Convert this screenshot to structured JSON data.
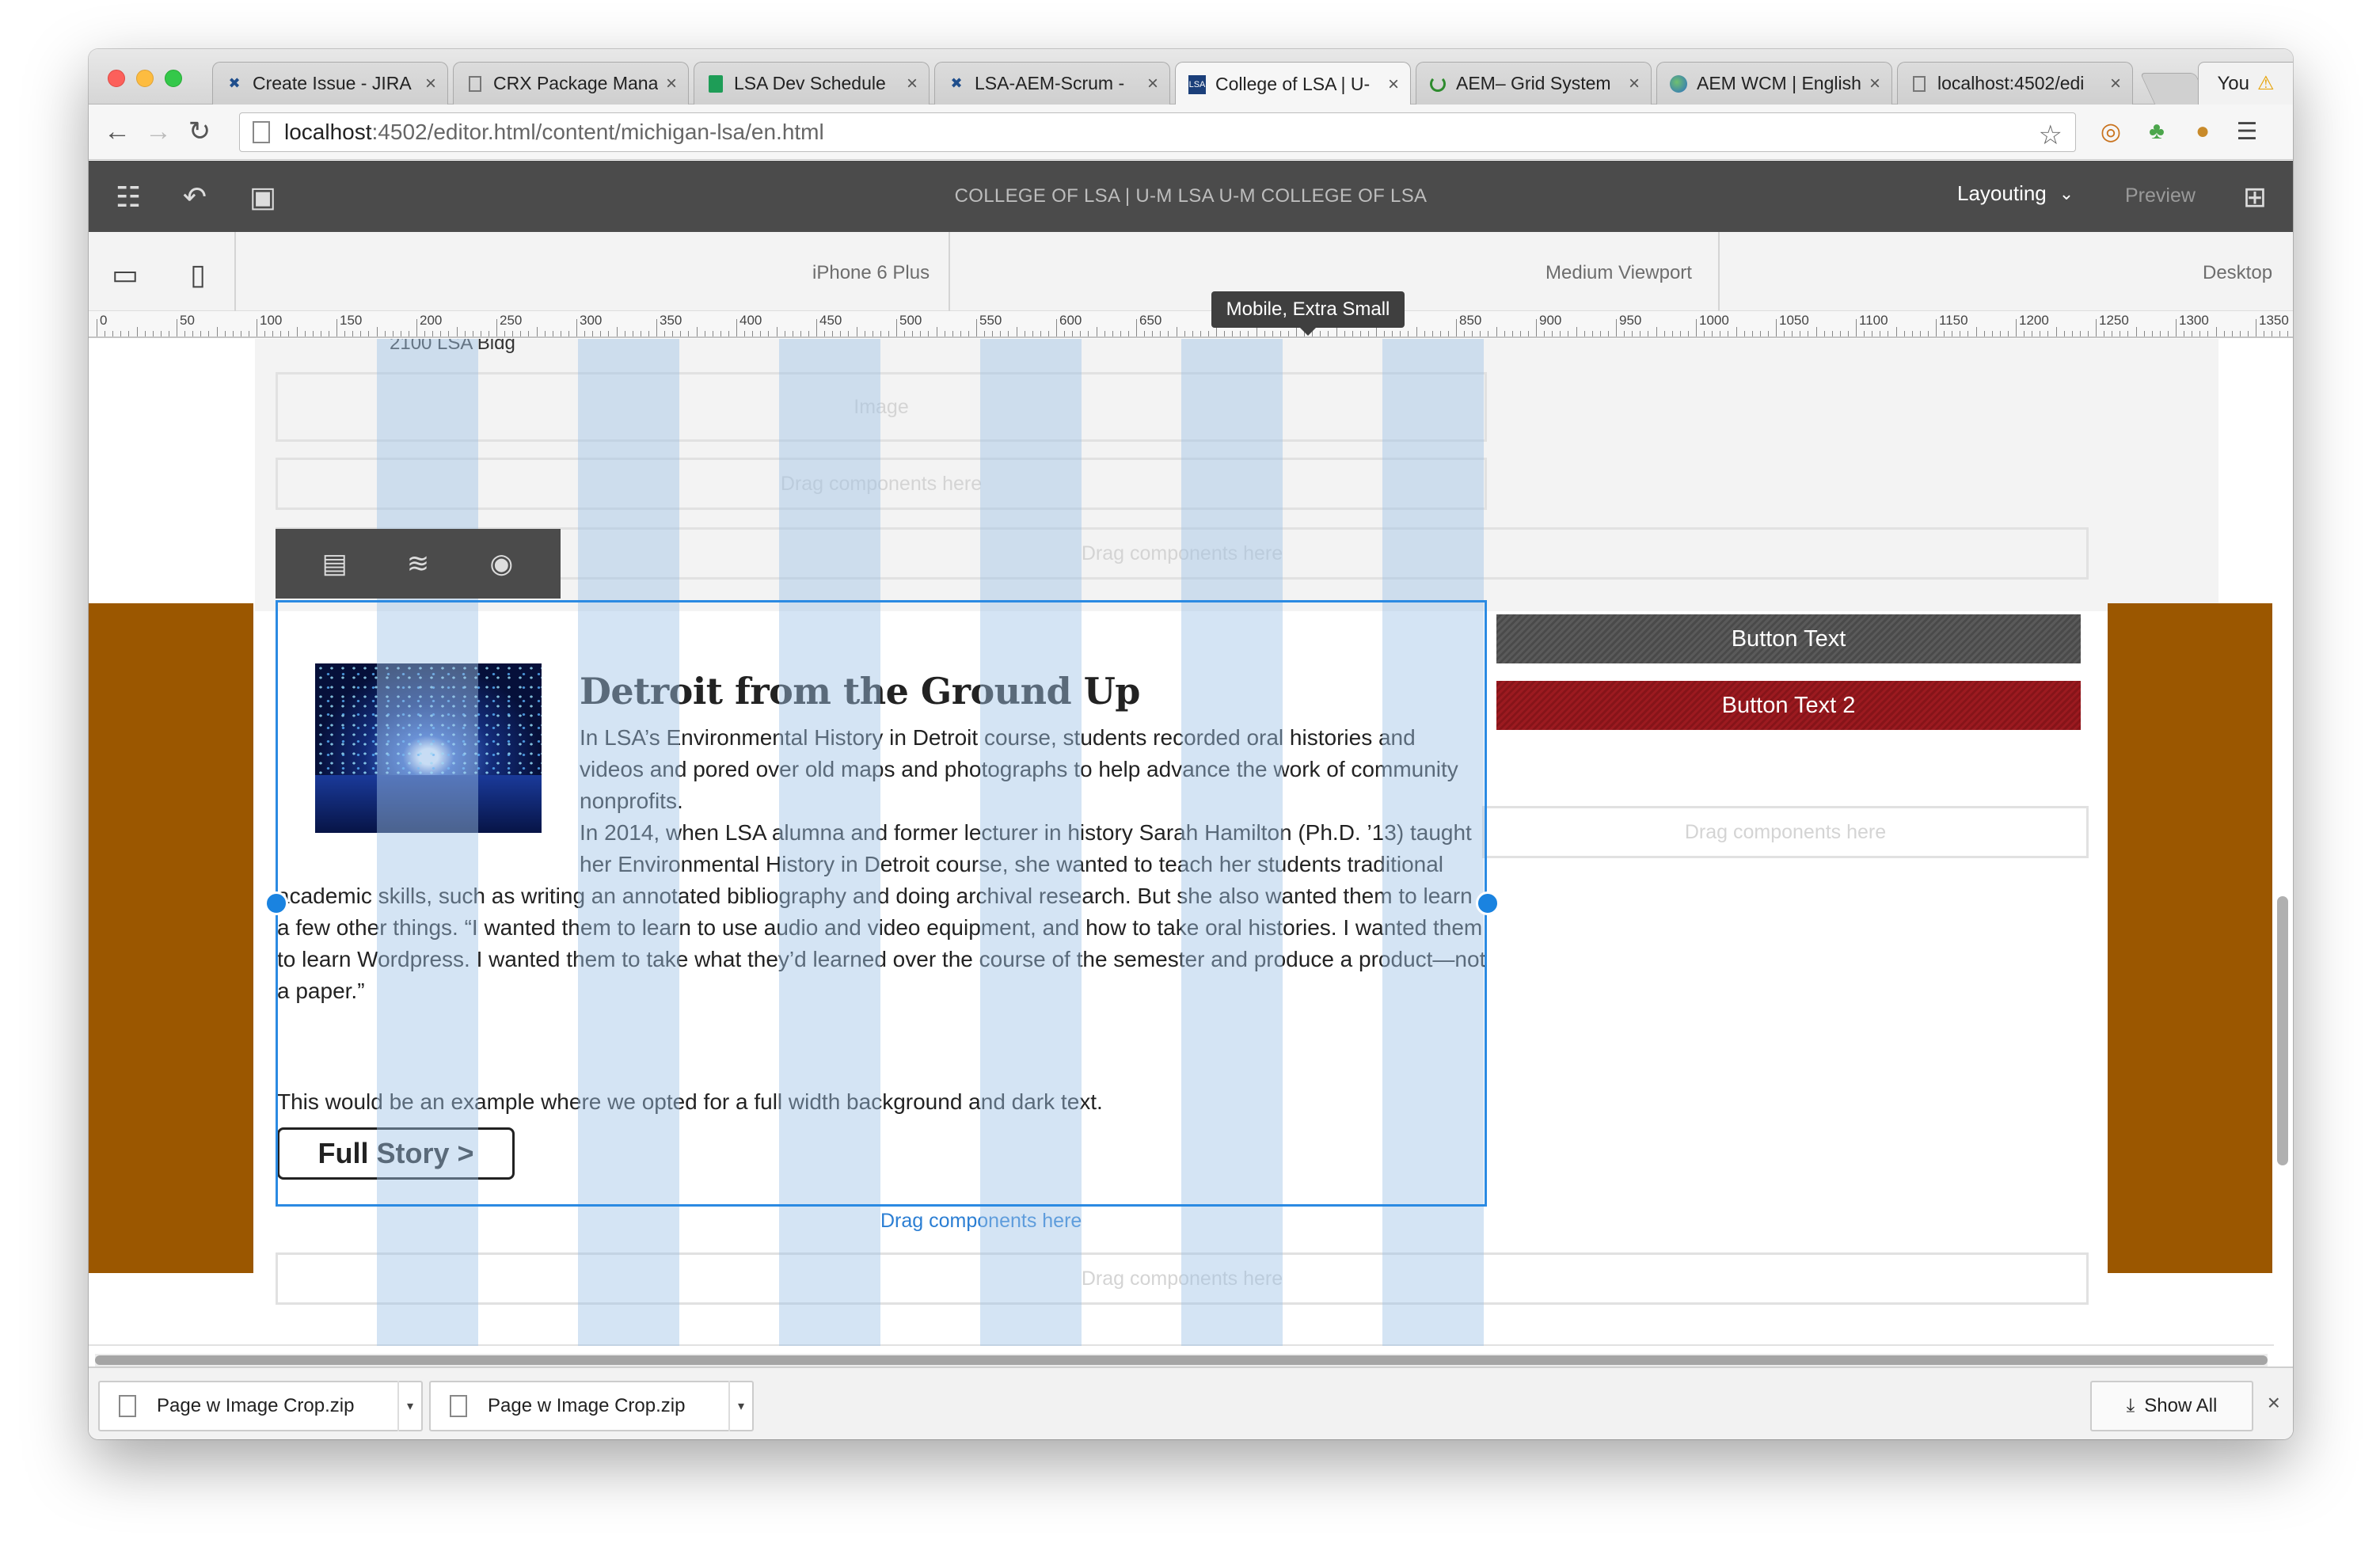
{
  "browser": {
    "tabs": [
      {
        "label": "Create Issue - JIRA",
        "icon": "jira-icon"
      },
      {
        "label": "CRX Package Manager",
        "icon": "page-icon"
      },
      {
        "label": "LSA Dev Schedule",
        "icon": "sheets-icon"
      },
      {
        "label": "LSA-AEM-Scrum -",
        "icon": "jira-icon"
      },
      {
        "label": "College of LSA | U-",
        "icon": "lsa-icon"
      },
      {
        "label": "AEM– Grid System",
        "icon": "loading-icon"
      },
      {
        "label": "AEM WCM | English",
        "icon": "globe-icon"
      },
      {
        "label": "localhost:4502/edi",
        "icon": "page-icon"
      }
    ],
    "active_tab_index": 4,
    "profile_label": "You",
    "url_host": "localhost",
    "url_rest": ":4502/editor.html/content/michigan-lsa/en.html"
  },
  "editor": {
    "title": "COLLEGE OF LSA | U-M LSA U-M COLLEGE OF LSA",
    "mode_label": "Layouting",
    "preview_label": "Preview"
  },
  "emulator": {
    "labels": [
      "iPhone 6 Plus",
      "Medium Viewport",
      "Desktop"
    ],
    "tooltip": "Mobile, Extra Small",
    "ruler_ticks": [
      "0",
      "50",
      "100",
      "150",
      "200",
      "250",
      "300",
      "350",
      "400",
      "450",
      "500",
      "550",
      "600",
      "650",
      "700",
      "750",
      "800",
      "850",
      "900",
      "950",
      "1000",
      "1050",
      "1100",
      "1150",
      "1200",
      "1250",
      "1300",
      "1350"
    ]
  },
  "page": {
    "address_line": "2100 LSA Bldg",
    "image_placeholder": "Image",
    "drag_here": "Drag components here",
    "story": {
      "title": "Detroit from the Ground Up",
      "para1": "In LSA’s Environmental History in Detroit course, students recorded oral histories and videos and pored over old maps and photographs to help advance the work of community nonprofits.",
      "para2_line1": "In 2014, when LSA alumna and former lecturer in history Sarah Hamilton (Ph.D. ’13) taught",
      "para2_line2": "her Environmental History in Detroit course, she wanted to teach her students traditional",
      "para2_rest": "academic skills, such as writing an annotated bibliography and doing archival research. But she also wanted them to learn a few other things. “I wanted them to learn to use audio and video equipment, and how to take oral histories. I wanted them to learn Wordpress. I wanted them to take what they’d learned over the course of the semester and produce a product—not a paper.”",
      "para3": "This would be an example where we opted for a full width background and dark text.",
      "cta": "Full Story >"
    },
    "button1": "Button Text",
    "button2": "Button Text 2"
  },
  "downloads": {
    "items": [
      "Page w Image Crop.zip",
      "Page w Image Crop.zip"
    ],
    "show_all": "Show All"
  },
  "colors": {
    "brown_band": "#9b5700",
    "selection_blue": "#2b8ae2",
    "button2_red": "#9c1a20"
  }
}
